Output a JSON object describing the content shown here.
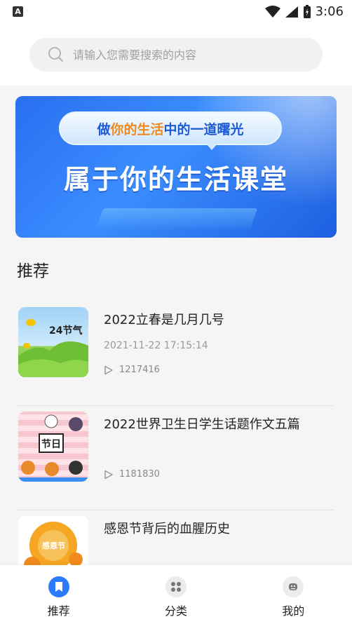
{
  "status_bar": {
    "time": "3:06"
  },
  "search": {
    "placeholder": "请输入您需要搜索的内容"
  },
  "banner": {
    "tagline_parts": [
      "做",
      "你的生活",
      "中的一道曙光"
    ],
    "title": "属于你的生活课堂"
  },
  "section": {
    "title": "推荐"
  },
  "items": [
    {
      "title": "2022立春是几月几号",
      "date": "2021-11-22 17:15:14",
      "views": "1217416",
      "thumb_text": "24节气"
    },
    {
      "title": "2022世界卫生日学生话题作文五篇",
      "date": "",
      "views": "1181830",
      "thumb_text": "节日"
    },
    {
      "title": "感恩节背后的血腥历史",
      "date": "",
      "views": "",
      "thumb_text": "感恩节"
    }
  ],
  "tabs": [
    {
      "label": "推荐",
      "icon": "bookmark-icon",
      "active": true
    },
    {
      "label": "分类",
      "icon": "grid-icon",
      "active": false
    },
    {
      "label": "我的",
      "icon": "user-icon",
      "active": false
    }
  ],
  "colors": {
    "accent": "#2b7bff",
    "banner_highlight": "#f08a1c"
  }
}
